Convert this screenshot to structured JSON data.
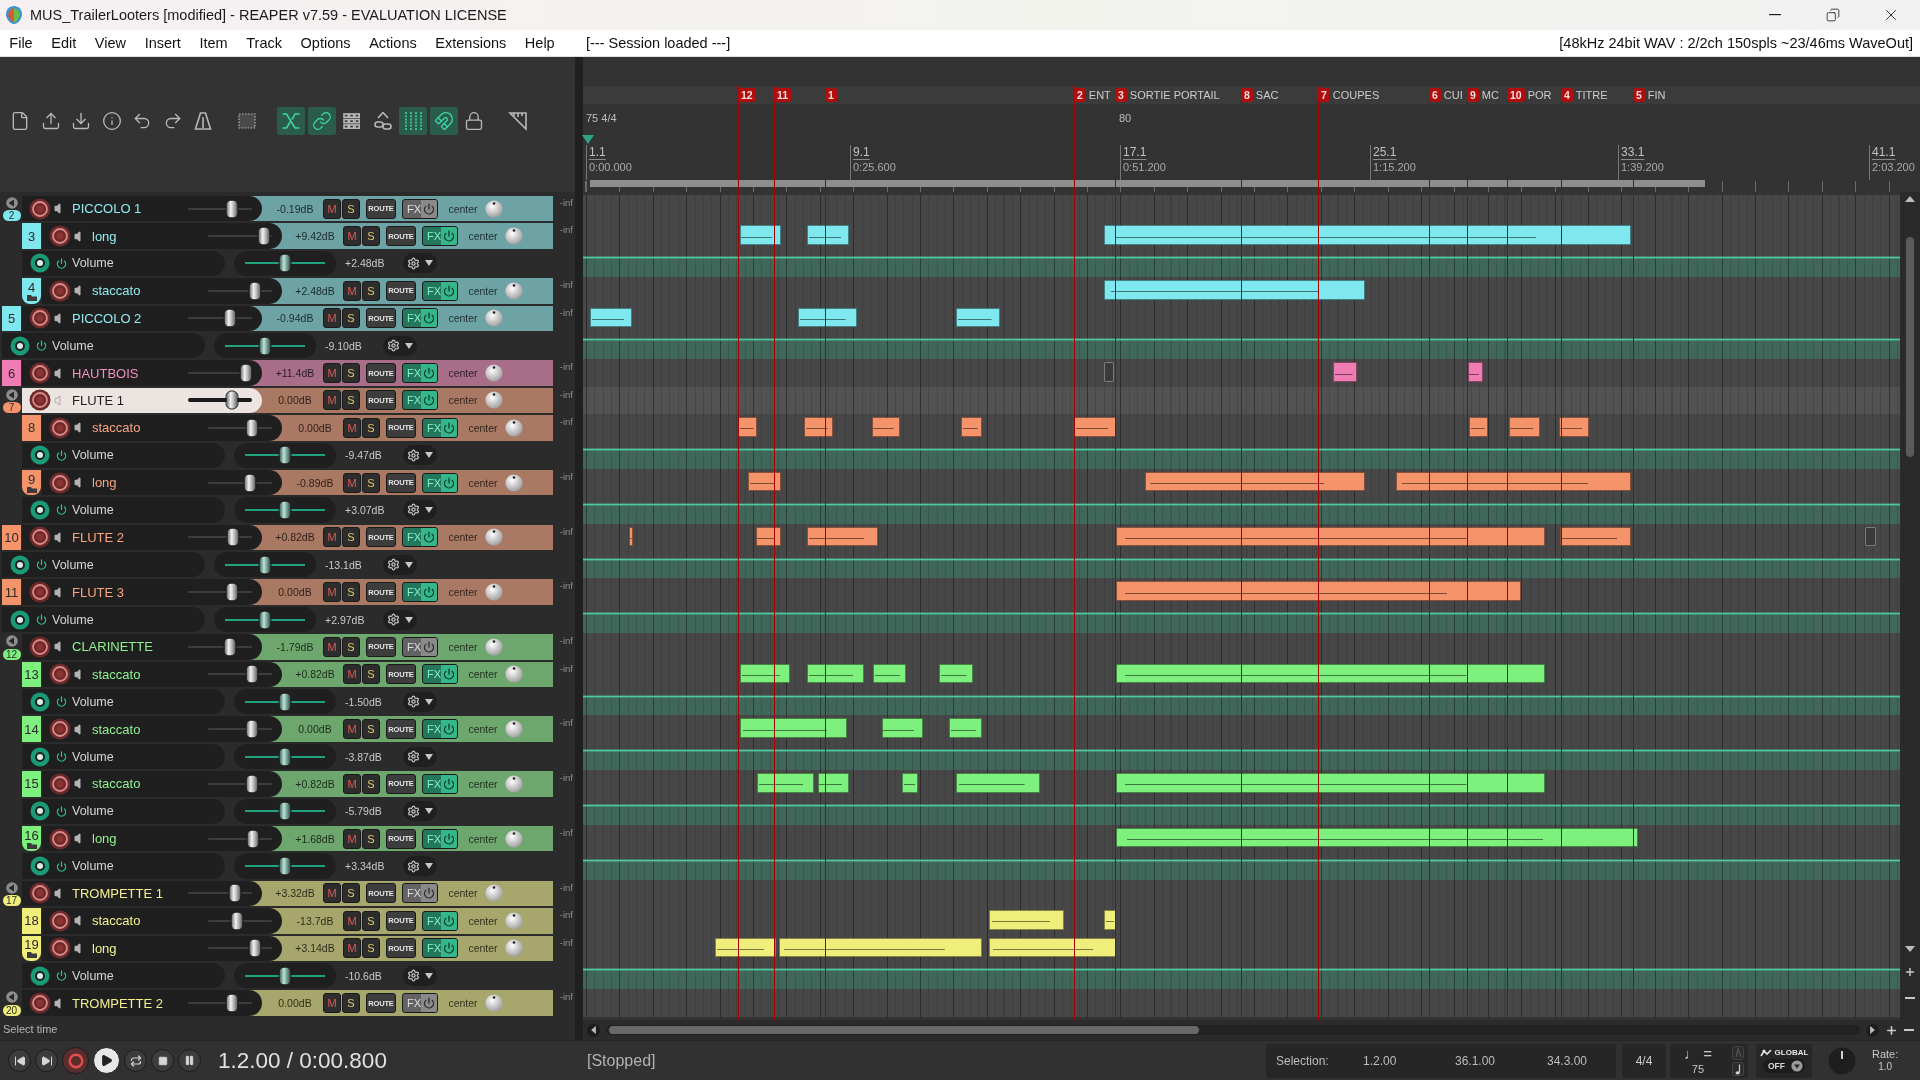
{
  "window": {
    "title": "MUS_TrailerLooters [modified] - REAPER v7.59 - EVALUATION LICENSE"
  },
  "menu": {
    "items": [
      "File",
      "Edit",
      "View",
      "Insert",
      "Item",
      "Track",
      "Options",
      "Actions",
      "Extensions",
      "Help"
    ],
    "status": "[--- Session loaded ---]",
    "audio_info": "[48kHz 24bit WAV : 2/2ch 150spls ~23/46ms WaveOut]"
  },
  "toolbar": [
    {
      "kind": "document",
      "on": false
    },
    {
      "kind": "upload",
      "on": false
    },
    {
      "kind": "download",
      "on": false
    },
    {
      "kind": "info",
      "on": false
    },
    {
      "kind": "undo",
      "on": false
    },
    {
      "kind": "redo",
      "on": false
    },
    {
      "kind": "metronome",
      "on": false
    },
    {
      "kind": "marquee",
      "on": false
    },
    {
      "kind": "crossfade",
      "on": true
    },
    {
      "kind": "link",
      "on": true
    },
    {
      "kind": "grid",
      "on": false
    },
    {
      "kind": "node-link",
      "on": false
    },
    {
      "kind": "grid-lines",
      "on": true
    },
    {
      "kind": "magnet",
      "on": true
    },
    {
      "kind": "lock",
      "on": false
    },
    {
      "kind": "ruler",
      "on": false
    }
  ],
  "ruler": {
    "tempo": "75 4/4",
    "tempo_change": "80",
    "markers": [
      {
        "number": "12"
      },
      {
        "number": "11"
      },
      {
        "number": "1"
      },
      {
        "number": "2",
        "label": "ENT"
      },
      {
        "number": "3",
        "label": "SORTIE PORTAIL"
      },
      {
        "number": "8",
        "label": "SAC"
      },
      {
        "number": "7",
        "label": "COUPES"
      },
      {
        "number": "6",
        "label": "CUI"
      },
      {
        "number": "9",
        "label": "MC"
      },
      {
        "number": "10",
        "label": "POR"
      },
      {
        "number": "4",
        "label": "TITRE"
      },
      {
        "number": "5",
        "label": "FIN"
      }
    ],
    "bars": [
      {
        "bar": "1.1",
        "time": "0:00.000"
      },
      {
        "bar": "9.1",
        "time": "0:25.600"
      },
      {
        "bar": "17.1",
        "time": "0:51.200"
      },
      {
        "bar": "25.1",
        "time": "1:15.200"
      },
      {
        "bar": "33.1",
        "time": "1:39.200"
      },
      {
        "bar": "41.1",
        "time": "2:03.200"
      }
    ]
  },
  "tracks": [
    {
      "number": "2",
      "name": "PICCOLO 1",
      "color": "#7ee8ee",
      "folder": true,
      "selected": false,
      "volume": "-0.19dB",
      "level": 0.68,
      "mute": "M",
      "solo": "S",
      "route": "ROUTE",
      "fx": "FX",
      "fx_enabled": false,
      "pan": "center",
      "meter": "-inf",
      "children": [
        {
          "number": "3",
          "name": "long",
          "color": "#7ee8ee",
          "folder": false,
          "selected": false,
          "volume": "+9.42dB",
          "level": 0.87,
          "mute": "M",
          "solo": "S",
          "route": "ROUTE",
          "fx": "FX",
          "fx_enabled": true,
          "pan": "center",
          "meter": "-inf",
          "envelopes": [
            {
              "name": "Volume",
              "reading": "+2.48dB",
              "level": 0.5
            }
          ]
        },
        {
          "number": "4",
          "name": "staccato",
          "color": "#7ee8ee",
          "folder": false,
          "selected": false,
          "volume": "+2.48dB",
          "level": 0.73,
          "mute": "M",
          "solo": "S",
          "route": "ROUTE",
          "fx": "FX",
          "fx_enabled": true,
          "pan": "center",
          "meter": "-inf"
        }
      ]
    },
    {
      "number": "5",
      "name": "PICCOLO 2",
      "color": "#7ee8ee",
      "folder": false,
      "selected": false,
      "volume": "-0.94dB",
      "level": 0.66,
      "mute": "M",
      "solo": "S",
      "route": "ROUTE",
      "fx": "FX",
      "fx_enabled": true,
      "pan": "center",
      "meter": "-inf",
      "envelopes": [
        {
          "name": "Volume",
          "reading": "-9.10dB",
          "level": 0.5
        }
      ]
    },
    {
      "number": "6",
      "name": "HAUTBOIS",
      "color": "#f07cb4",
      "folder": false,
      "selected": false,
      "volume": "+11.4dB",
      "level": 0.91,
      "mute": "M",
      "solo": "S",
      "route": "ROUTE",
      "fx": "FX",
      "fx_enabled": true,
      "pan": "center",
      "meter": "-inf"
    },
    {
      "number": "7",
      "name": "FLUTE 1",
      "color": "#f5946a",
      "folder": true,
      "selected": true,
      "volume": "0.00dB",
      "level": 0.69,
      "mute": "M",
      "solo": "S",
      "route": "ROUTE",
      "fx": "FX",
      "fx_enabled": true,
      "pan": "center",
      "meter": "-inf",
      "children": [
        {
          "number": "8",
          "name": "staccato",
          "color": "#f5946a",
          "folder": false,
          "selected": false,
          "volume": "0.00dB",
          "level": 0.68,
          "mute": "M",
          "solo": "S",
          "route": "ROUTE",
          "fx": "FX",
          "fx_enabled": true,
          "pan": "center",
          "meter": "-inf",
          "envelopes": [
            {
              "name": "Volume",
              "reading": "-9.47dB",
              "level": 0.5
            }
          ]
        },
        {
          "number": "9",
          "name": "long",
          "color": "#f5946a",
          "folder": false,
          "selected": false,
          "volume": "-0.89dB",
          "level": 0.66,
          "mute": "M",
          "solo": "S",
          "route": "ROUTE",
          "fx": "FX",
          "fx_enabled": true,
          "pan": "center",
          "meter": "-inf",
          "envelopes": [
            {
              "name": "Volume",
              "reading": "+3.07dB",
              "level": 0.5
            }
          ]
        }
      ]
    },
    {
      "number": "10",
      "name": "FLUTE 2",
      "color": "#f5946a",
      "folder": false,
      "selected": false,
      "volume": "+0.82dB",
      "level": 0.7,
      "mute": "M",
      "solo": "S",
      "route": "ROUTE",
      "fx": "FX",
      "fx_enabled": true,
      "pan": "center",
      "meter": "-inf",
      "envelopes": [
        {
          "name": "Volume",
          "reading": "-13.1dB",
          "level": 0.5
        }
      ]
    },
    {
      "number": "11",
      "name": "FLUTE 3",
      "color": "#f5946a",
      "folder": false,
      "selected": false,
      "volume": "0.00dB",
      "level": 0.68,
      "mute": "M",
      "solo": "S",
      "route": "ROUTE",
      "fx": "FX",
      "fx_enabled": true,
      "pan": "center",
      "meter": "-inf",
      "envelopes": [
        {
          "name": "Volume",
          "reading": "+2.97dB",
          "level": 0.5
        }
      ]
    },
    {
      "number": "12",
      "name": "CLARINETTE",
      "color": "#7ef07e",
      "folder": true,
      "selected": false,
      "volume": "-1.79dB",
      "level": 0.65,
      "mute": "M",
      "solo": "S",
      "route": "ROUTE",
      "fx": "FX",
      "fx_enabled": false,
      "pan": "center",
      "meter": "-inf",
      "children": [
        {
          "number": "13",
          "name": "staccato",
          "color": "#7ef07e",
          "folder": false,
          "selected": false,
          "volume": "+0.82dB",
          "level": 0.69,
          "mute": "M",
          "solo": "S",
          "route": "ROUTE",
          "fx": "FX",
          "fx_enabled": true,
          "pan": "center",
          "meter": "-inf",
          "envelopes": [
            {
              "name": "Volume",
              "reading": "-1.50dB",
              "level": 0.5
            }
          ]
        },
        {
          "number": "14",
          "name": "staccato",
          "color": "#7ef07e",
          "folder": false,
          "selected": false,
          "volume": "0.00dB",
          "level": 0.68,
          "mute": "M",
          "solo": "S",
          "route": "ROUTE",
          "fx": "FX",
          "fx_enabled": true,
          "pan": "center",
          "meter": "-inf",
          "envelopes": [
            {
              "name": "Volume",
              "reading": "-3.87dB",
              "level": 0.5
            }
          ]
        },
        {
          "number": "15",
          "name": "staccato",
          "color": "#7ef07e",
          "folder": false,
          "selected": false,
          "volume": "+0.82dB",
          "level": 0.69,
          "mute": "M",
          "solo": "S",
          "route": "ROUTE",
          "fx": "FX",
          "fx_enabled": true,
          "pan": "center",
          "meter": "-inf",
          "envelopes": [
            {
              "name": "Volume",
              "reading": "-5.79dB",
              "level": 0.5
            }
          ]
        },
        {
          "number": "16",
          "name": "long",
          "color": "#7ef07e",
          "folder": false,
          "selected": false,
          "volume": "+1.68dB",
          "level": 0.71,
          "mute": "M",
          "solo": "S",
          "route": "ROUTE",
          "fx": "FX",
          "fx_enabled": true,
          "pan": "center",
          "meter": "-inf",
          "envelopes": [
            {
              "name": "Volume",
              "reading": "+3.34dB",
              "level": 0.5
            }
          ]
        }
      ]
    },
    {
      "number": "17",
      "name": "TROMPETTE 1",
      "color": "#f0ee7a",
      "folder": true,
      "selected": false,
      "volume": "+3.32dB",
      "level": 0.74,
      "mute": "M",
      "solo": "S",
      "route": "ROUTE",
      "fx": "FX",
      "fx_enabled": false,
      "pan": "center",
      "meter": "-inf",
      "children": [
        {
          "number": "18",
          "name": "staccato",
          "color": "#f0ee7a",
          "folder": false,
          "selected": false,
          "volume": "-13.7dB",
          "level": 0.46,
          "mute": "M",
          "solo": "S",
          "route": "ROUTE",
          "fx": "FX",
          "fx_enabled": true,
          "pan": "center",
          "meter": "-inf"
        },
        {
          "number": "19",
          "name": "long",
          "color": "#f0ee7a",
          "folder": false,
          "selected": false,
          "volume": "+3.14dB",
          "level": 0.74,
          "mute": "M",
          "solo": "S",
          "route": "ROUTE",
          "fx": "FX",
          "fx_enabled": true,
          "pan": "center",
          "meter": "-inf",
          "envelopes": [
            {
              "name": "Volume",
              "reading": "-10.6dB",
              "level": 0.5
            }
          ]
        }
      ]
    },
    {
      "number": "20",
      "name": "TROMPETTE 2",
      "color": "#f0ee7a",
      "folder": true,
      "selected": false,
      "volume": "0.00dB",
      "level": 0.69,
      "mute": "M",
      "solo": "S",
      "route": "ROUTE",
      "fx": "FX",
      "fx_enabled": false,
      "pan": "center",
      "meter": "-inf"
    }
  ],
  "hint": "Select time",
  "transport": {
    "position": "1.2.00 / 0:00.800",
    "state": "[Stopped]",
    "selection": {
      "label": "Selection:",
      "start": "1.2.00",
      "end": "36.1.00",
      "length": "34.3.00"
    },
    "time_signature": "4/4",
    "tempo_symbol": "♩ =",
    "tempo": "75",
    "automation": {
      "label": "GLOBAL",
      "value": "OFF"
    },
    "rate_label": "Rate:",
    "rate": "1.0"
  }
}
